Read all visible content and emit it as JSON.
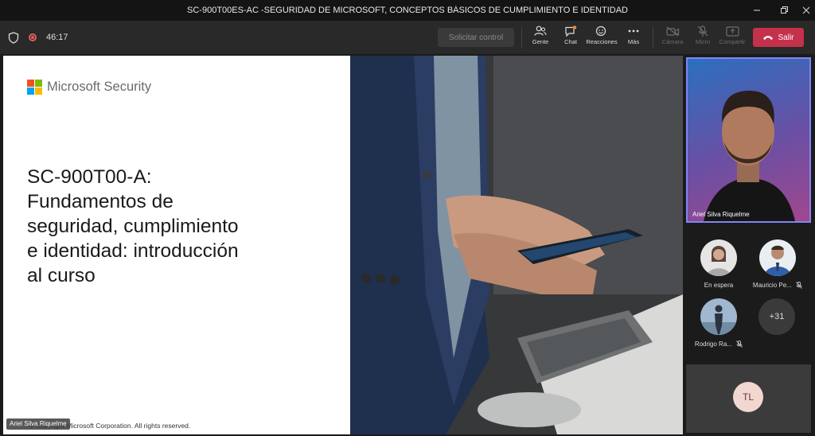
{
  "window": {
    "title": "SC-900T00ES-AC -SEGURIDAD DE MICROSOFT, CONCEPTOS BÁSICOS DE CUMPLIMIENTO E IDENTIDAD"
  },
  "toolbar": {
    "elapsed": "46:17",
    "request_control": "Solicitar control",
    "people": "Gente",
    "chat": "Chat",
    "reactions": "Reacciones",
    "more": "Más",
    "camera": "Cámara",
    "mic": "Micro",
    "share": "Compartir",
    "leave": "Salir",
    "leave_color": "#c4314b"
  },
  "slide": {
    "brand": "Microsoft Security",
    "title_lines": [
      "SC-900T00-A:",
      "Fundamentos de",
      "seguridad, cumplimiento",
      "e identidad: introducción",
      "al curso"
    ],
    "copyright": "© Copyright Microsoft Corporation. All rights reserved.",
    "presenter_tag": "Ariel Silva Riquelme",
    "logo_colors": [
      "#f25022",
      "#7fba00",
      "#00a4ef",
      "#ffb900"
    ]
  },
  "camera": {
    "name": "Ariel Silva Riquelme",
    "highlight_color": "#7f85f5"
  },
  "participants": [
    {
      "label": "En espera",
      "muted": false
    },
    {
      "label": "Mauricio Pe...",
      "muted": true
    },
    {
      "label": "Rodrigo Ra...",
      "muted": true
    }
  ],
  "overflow_count": "+31",
  "tile_initials": "TL"
}
